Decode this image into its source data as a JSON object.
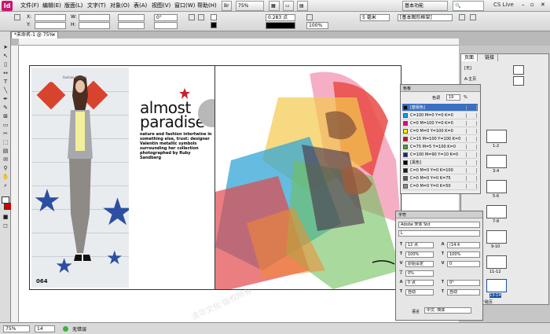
{
  "menubar": {
    "logo": "Id",
    "items": [
      "文件(F)",
      "编辑(E)",
      "版面(L)",
      "文字(T)",
      "对象(O)",
      "表(A)",
      "视图(V)",
      "窗口(W)",
      "帮助(H)"
    ],
    "zoom": "75%",
    "workspace": "基本功能",
    "live": "CS Live"
  },
  "control": {
    "font_size": "0.283 点",
    "stroke": "5 毫米",
    "scale": "100%",
    "style": "[基本图形框架]",
    "x_label": "X:",
    "y_label": "Y:",
    "w_label": "W:",
    "h_label": "H:",
    "angle": "0°"
  },
  "document": {
    "tab_title": "*未命名-1 @ 75%",
    "page_number": "064",
    "kicker": "fashion feature",
    "headline": "almost paradise",
    "dek": "nature and fashion intertwine in something else, trust: designer Valentin metallic symbols surrounding her collection photographed by Ruby Sandberg"
  },
  "pages_panel": {
    "tabs": [
      "页面",
      "链接"
    ],
    "master_label": "[无]",
    "master_a": "A-主页",
    "thumbs": [
      "1-2",
      "3-4",
      "5-6",
      "7-8",
      "9-10",
      "11-12",
      "13-14"
    ],
    "status": "14 页, 7 个跨页"
  },
  "swatches_panel": {
    "title": "色板",
    "tint_label": "色调",
    "tint_value": "19",
    "percent": "%",
    "rows": [
      {
        "name": "[套版色]",
        "color": "#000000",
        "selected": true
      },
      {
        "name": "C=100 M=0 Y=0 K=0",
        "color": "#00a0e9"
      },
      {
        "name": "C=0 M=100 Y=0 K=0",
        "color": "#e4007f"
      },
      {
        "name": "C=0 M=0 Y=100 K=0",
        "color": "#fff100"
      },
      {
        "name": "C=15 M=100 Y=100 K=0",
        "color": "#c30d23"
      },
      {
        "name": "C=75 M=5 Y=100 K=0",
        "color": "#3aa535"
      },
      {
        "name": "C=100 M=90 Y=10 K=0",
        "color": "#1d2088"
      },
      {
        "name": "[黑色]",
        "color": "#000000"
      },
      {
        "name": "C=0 M=0 Y=0 K=100",
        "color": "#231815"
      },
      {
        "name": "C=0 M=0 Y=0 K=75",
        "color": "#595757"
      },
      {
        "name": "C=0 M=0 Y=0 K=50",
        "color": "#898989"
      }
    ]
  },
  "char_panel": {
    "title": "字符",
    "font": "Adobe 宋体 Std",
    "style": "L",
    "size": "12 点",
    "leading": "(14.4",
    "kern": "原始设定",
    "track": "0",
    "vscale": "100%",
    "hscale": "100%",
    "baseline": "0 点",
    "skew": "0°",
    "auto1": "自动",
    "auto2": "自动",
    "lang_label": "语言",
    "lang": "中文: 简体"
  },
  "status": {
    "page": "14",
    "preflight": "无错误"
  },
  "watermark": "清华文化 版权所有"
}
